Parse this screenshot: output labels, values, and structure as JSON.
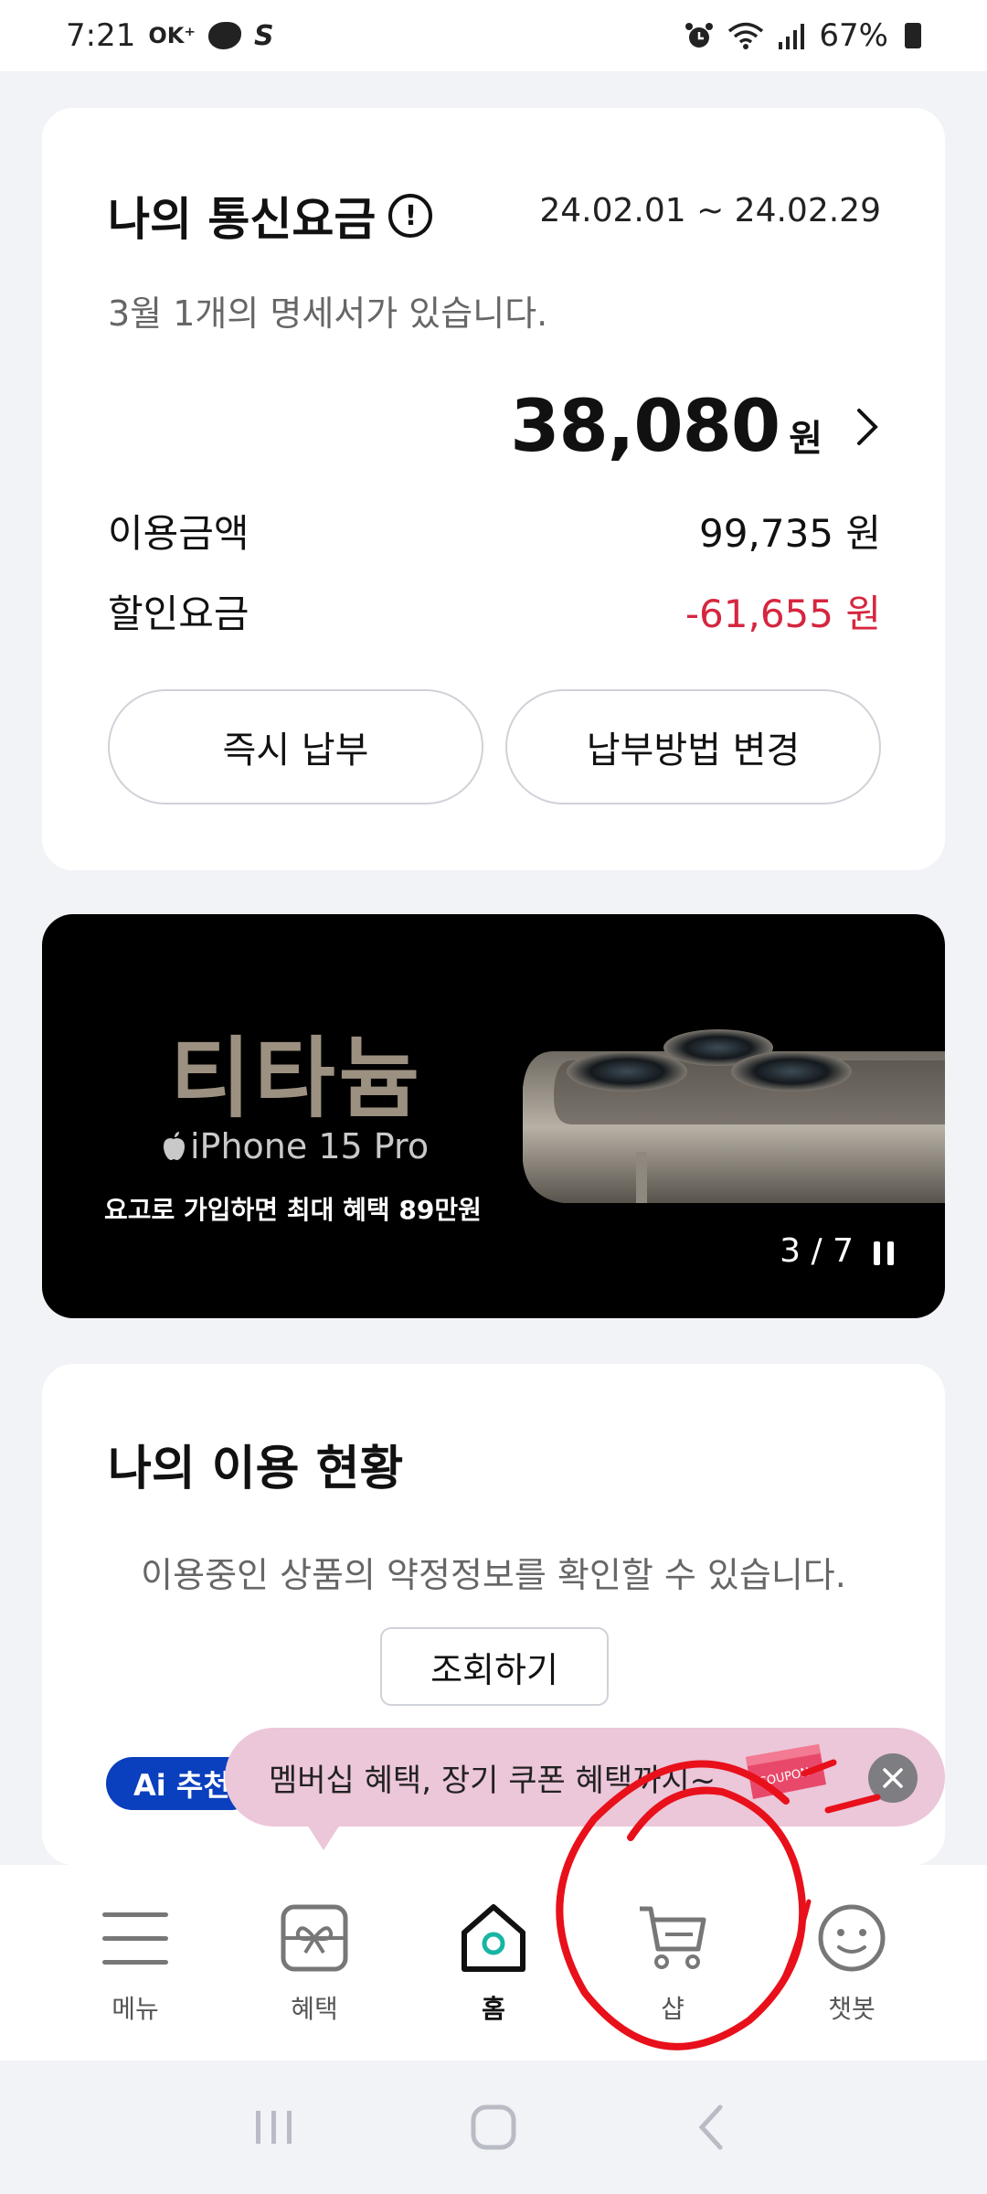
{
  "status_bar": {
    "time": "7:21",
    "notif_text": "OK⁺",
    "s_icon": "S",
    "battery": "67%"
  },
  "bill": {
    "title": "나의 통신요금",
    "info_icon": "!",
    "period": "24.02.01 ~ 24.02.29",
    "notice": "3월 1개의 명세서가 있습니다.",
    "total": "38,080",
    "total_unit": "원",
    "usage_label": "이용금액",
    "usage_value": "99,735 원",
    "discount_label": "할인요금",
    "discount_value": "-61,655 원",
    "pay_now": "즉시 납부",
    "change_method": "납부방법 변경"
  },
  "banner": {
    "title": "티타늄",
    "product": "iPhone 15 Pro",
    "subtitle": "요고로 가입하면 최대 혜택 89만원",
    "counter": "3 / 7"
  },
  "usage": {
    "title": "나의 이용 현황",
    "description": "이용중인 상품의 약정정보를 확인할 수 있습니다.",
    "lookup_button": "조회하기",
    "ai_badge": "Ai 추천"
  },
  "promo": {
    "text": "멤버십 혜택, 장기 쿠폰 혜택까지~",
    "coupon_label": "COUPON"
  },
  "nav": {
    "items": [
      {
        "label": "메뉴",
        "icon": "menu-icon"
      },
      {
        "label": "혜택",
        "icon": "gift-icon"
      },
      {
        "label": "홈",
        "icon": "home-icon"
      },
      {
        "label": "샵",
        "icon": "cart-icon"
      },
      {
        "label": "챗봇",
        "icon": "chatbot-icon"
      }
    ],
    "active": "홈"
  },
  "colors": {
    "discount": "#d6263f",
    "ai_badge": "#0a3fbd",
    "toast": "#ecc6d9",
    "annotation": "#e8101a",
    "home_accent": "#18b5a5"
  }
}
